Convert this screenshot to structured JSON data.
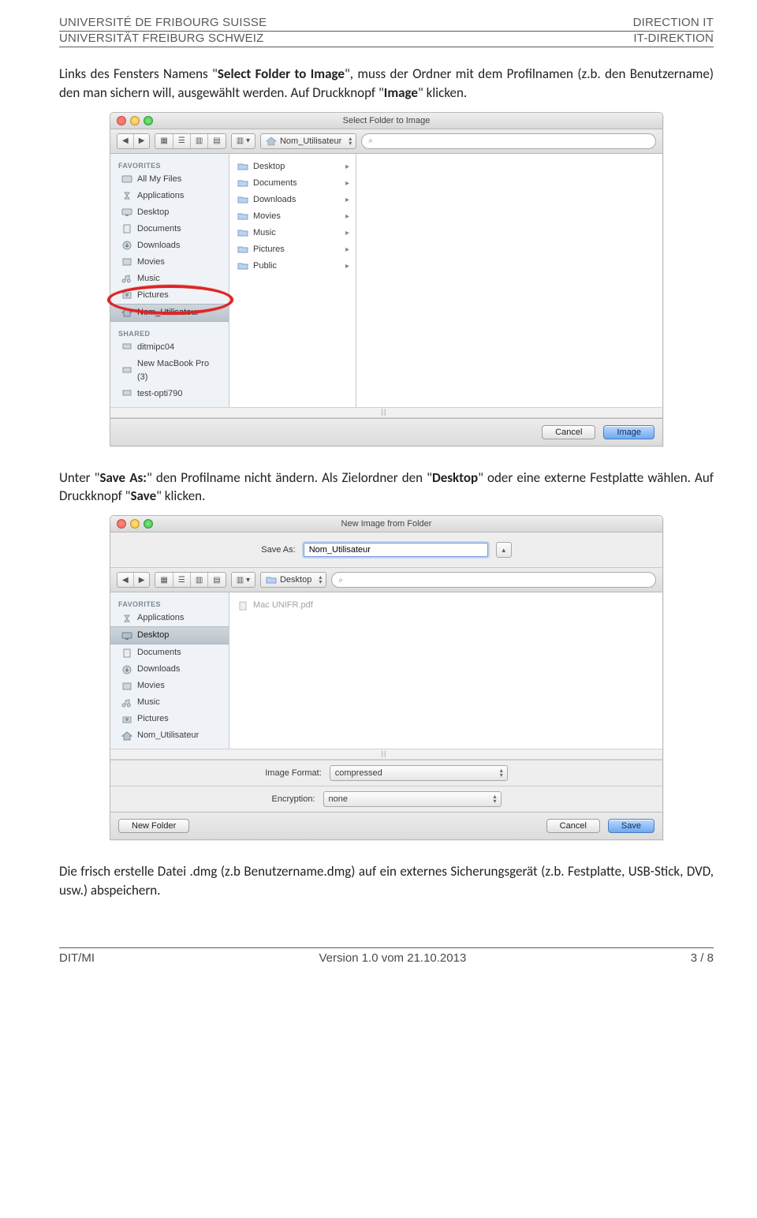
{
  "header": {
    "fr": "UNIVERSITÉ DE FRIBOURG SUISSE",
    "de": "UNIVERSITÄT FREIBURG SCHWEIZ",
    "right_fr": "DIRECTION IT",
    "right_de": "IT-DIREKTION"
  },
  "para1_a": "Links des Fensters Namens \"",
  "para1_bold1": "Select Folder to Image",
  "para1_b": "\", muss der Ordner mit dem Profilnamen (z.b. den Benutzername) den man sichern will, ausgewählt werden. Auf Druckknopf \"",
  "para1_bold2": "Image",
  "para1_c": "\" klicken.",
  "win1": {
    "title": "Select Folder to Image",
    "path": "Nom_Utilisateur",
    "search_icon": "⌕",
    "fav_head": "FAVORITES",
    "favorites": [
      "All My Files",
      "Applications",
      "Desktop",
      "Documents",
      "Downloads",
      "Movies",
      "Music",
      "Pictures",
      "Nom_Utilisateur"
    ],
    "shared_head": "SHARED",
    "shared": [
      "ditmipc04",
      "New MacBook Pro (3)",
      "test-opti790"
    ],
    "folders": [
      "Desktop",
      "Documents",
      "Downloads",
      "Movies",
      "Music",
      "Pictures",
      "Public"
    ],
    "cancel": "Cancel",
    "go": "Image"
  },
  "para2_a": "Unter \"",
  "para2_bold1": "Save As:",
  "para2_b": "\" den Profilname nicht ändern. Als Zielordner den \"",
  "para2_bold2": "Desktop",
  "para2_c": "\" oder eine externe Festplatte wählen. Auf Druckknopf \"",
  "para2_bold3": "Save",
  "para2_d": "\" klicken.",
  "win2": {
    "title": "New Image from Folder",
    "saveas_label": "Save As:",
    "saveas_value": "Nom_Utilisateur",
    "path": "Desktop",
    "fav_head": "FAVORITES",
    "favorites": [
      "Applications",
      "Desktop",
      "Documents",
      "Downloads",
      "Movies",
      "Music",
      "Pictures",
      "Nom_Utilisateur"
    ],
    "file": "Mac UNIFR.pdf",
    "fmt_label": "Image Format:",
    "fmt_value": "compressed",
    "enc_label": "Encryption:",
    "enc_value": "none",
    "newfolder": "New Folder",
    "cancel": "Cancel",
    "go": "Save"
  },
  "para3": "Die frisch erstelle Datei .dmg (z.b Benutzername.dmg) auf ein externes Sicherungsgerät (z.b. Festplatte, USB-Stick, DVD, usw.) abspeichern.",
  "footer": {
    "left": "DIT/MI",
    "center": "Version 1.0 vom 21.10.2013",
    "right": "3 / 8"
  }
}
